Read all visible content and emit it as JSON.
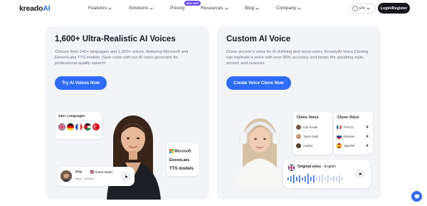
{
  "brand": {
    "logo_main": "kreado",
    "logo_ai": "AI"
  },
  "nav": {
    "items": [
      {
        "label": "Features",
        "dropdown": true
      },
      {
        "label": "Solutions",
        "dropdown": true
      },
      {
        "label": "Pricing",
        "dropdown": false
      },
      {
        "label": "Resources",
        "dropdown": true
      },
      {
        "label": "Blog",
        "dropdown": true
      },
      {
        "label": "Company",
        "dropdown": true
      }
    ],
    "pricing_badge": "99% OFF",
    "language": "EN",
    "login_label": "Login/Register"
  },
  "left_card": {
    "title": "1,600+ Ultra-Realistic AI Voices",
    "description": "Choose from 140+ languages and 1,600+ voices, featuring Microsoft and ElevenLabs TTS models. Save costs with our AI voice generator for professional-quality speech!",
    "cta": "Try AI Voices Now",
    "languages_label": "140+ Languages",
    "flags": [
      "uk",
      "germany",
      "france",
      "jordan",
      "turkey"
    ],
    "providers": [
      "Microsoft",
      "ElevenLabs",
      "TTS models"
    ],
    "voice_sample": {
      "name": "Guy",
      "accent": "United States",
      "tags": "Male · Cheerful"
    }
  },
  "right_card": {
    "title": "Custom AI Voice",
    "description": "Clone anyone's voice for AI dubbing and voice-overs. KreadoAI Voice Cloning can replicate a voice with over 98% accuracy and keeps the speaking style, accent, and nuances.",
    "cta": "Create Voice Clone Now",
    "clone_voice_header": "Clone Voice",
    "clone_voices_a": [
      {
        "name": "Kim Novak",
        "color": "#7a5a48"
      },
      {
        "name": "Taylor Swift",
        "color": "#c99a74"
      },
      {
        "name": "Andrea",
        "color": "#5a4032"
      }
    ],
    "clone_voices_b": [
      {
        "name": "French",
        "flag": "france"
      },
      {
        "name": "Russian",
        "flag": "russia"
      },
      {
        "name": "Spanish",
        "flag": "spain"
      }
    ],
    "original_voice": {
      "label": "Original voice",
      "language": "English"
    }
  },
  "colors": {
    "accent": "#2f6bff",
    "badge": "#6c4cff",
    "card_bg": "#f3f4f7"
  },
  "icons": {
    "chat": "chat-bubble-icon",
    "globe": "globe-icon"
  }
}
